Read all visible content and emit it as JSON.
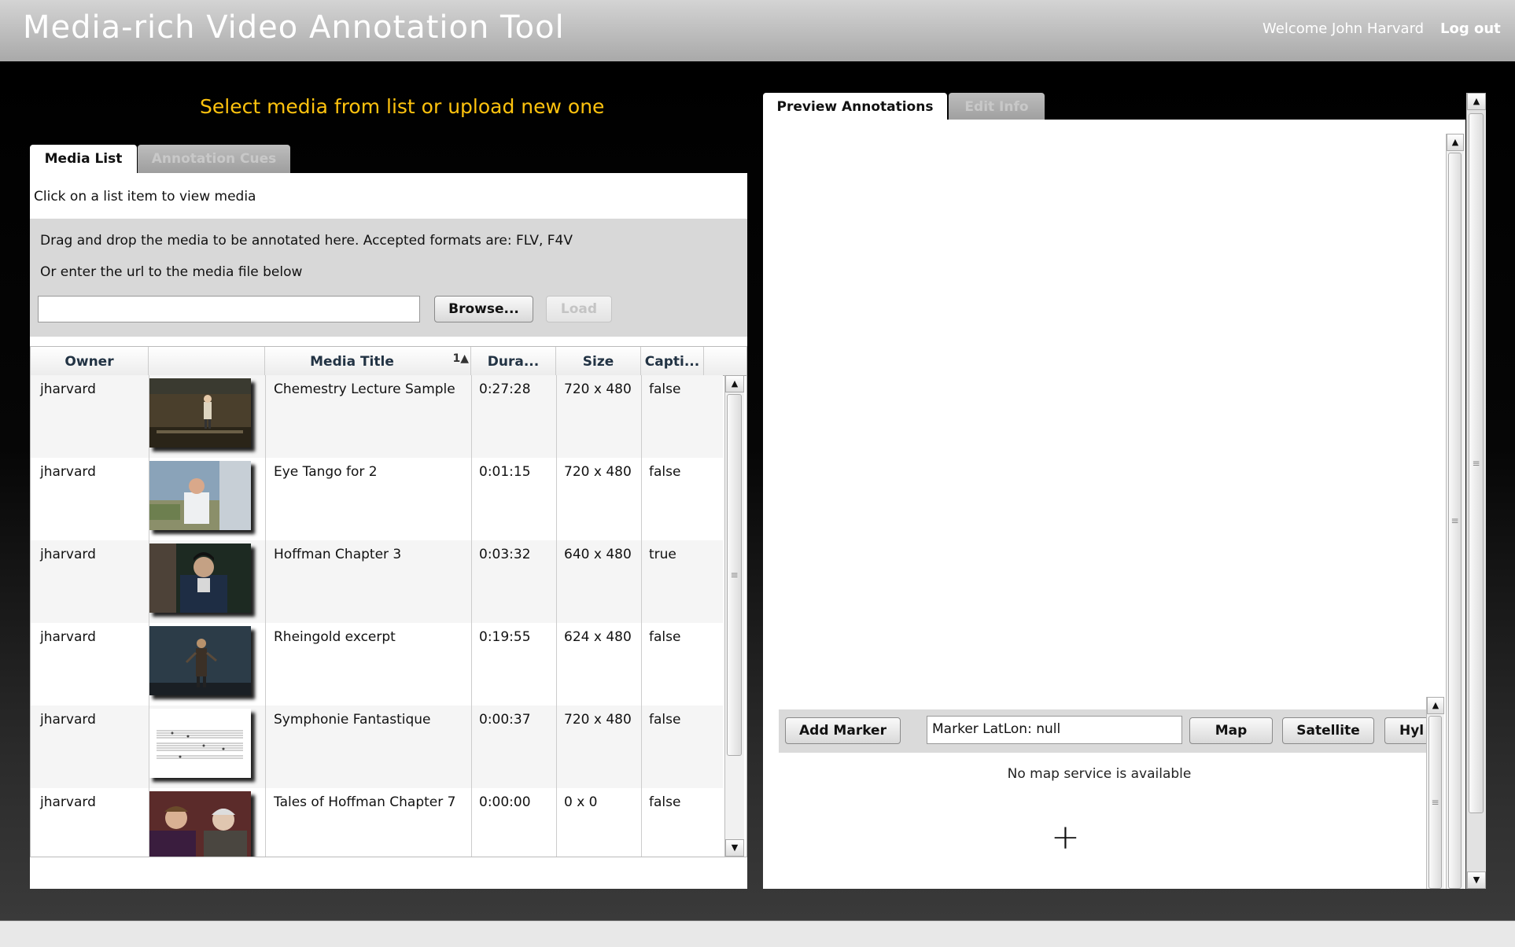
{
  "header": {
    "title": "Media-rich Video Annotation Tool",
    "welcome": "Welcome John Harvard",
    "logout": "Log out"
  },
  "select_hint": "Select media from list or upload new one",
  "left_tabs": [
    "Media List",
    "Annotation Cues"
  ],
  "media_list": {
    "instruction": "Click on a list item to view media",
    "upload_text": "Drag and drop the media to be annotated here. Accepted formats are: FLV, F4V",
    "url_text": "Or enter the url to the media file below",
    "url_value": "",
    "browse_label": "Browse...",
    "load_label": "Load"
  },
  "grid": {
    "columns": [
      "Owner",
      "",
      "Media Title",
      "Dura...",
      "Size",
      "Capti..."
    ],
    "sort_indicator": "1▲",
    "rows": [
      {
        "owner": "jharvard",
        "title": "Chemestry Lecture Sample",
        "duration": "0:27:28",
        "size": "720 x 480",
        "caption": "false",
        "thumb": "lecture-hall"
      },
      {
        "owner": "jharvard",
        "title": "Eye Tango for 2",
        "duration": "0:01:15",
        "size": "720 x 480",
        "caption": "false",
        "thumb": "outdoor-man"
      },
      {
        "owner": "jharvard",
        "title": "Hoffman Chapter 3",
        "duration": "0:03:32",
        "size": "640 x 480",
        "caption": "true",
        "thumb": "opera-portrait"
      },
      {
        "owner": "jharvard",
        "title": "Rheingold excerpt",
        "duration": "0:19:55",
        "size": "624 x 480",
        "caption": "false",
        "thumb": "stage-figure"
      },
      {
        "owner": "jharvard",
        "title": "Symphonie Fantastique",
        "duration": "0:00:37",
        "size": "720 x 480",
        "caption": "false",
        "thumb": "music-score"
      },
      {
        "owner": "jharvard",
        "title": "Tales of Hoffman Chapter 7",
        "duration": "0:00:00",
        "size": "0 x 0",
        "caption": "false",
        "thumb": "two-actors"
      }
    ]
  },
  "right_tabs": [
    "Preview Annotations",
    "Edit Info"
  ],
  "map": {
    "add_marker_label": "Add Marker",
    "marker_latlon": "Marker LatLon: null",
    "map_label": "Map",
    "satellite_label": "Satellite",
    "hybrid_label": "Hyl",
    "no_map_text": "No map service is available"
  },
  "colors": {
    "hint": "#ffc30e",
    "header_bg": "#b8b8b8",
    "background": "#000000"
  }
}
